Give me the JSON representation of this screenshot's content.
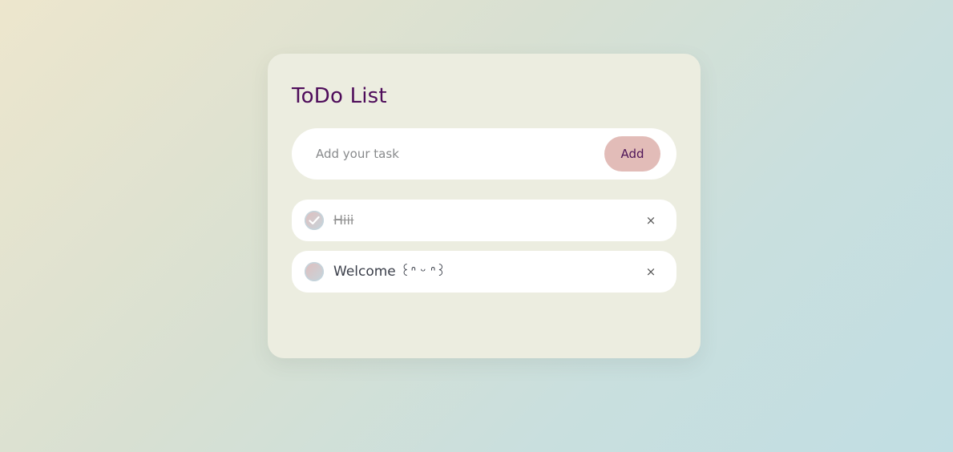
{
  "header": {
    "title": "ToDo List"
  },
  "new_task": {
    "placeholder": "Add your task",
    "value": "",
    "add_label": "Add"
  },
  "todos": [
    {
      "text": "Hiii",
      "done": true,
      "delete_label": "×"
    },
    {
      "text": "Welcome ꒰ᐢ ᵕ ᐢ꒱",
      "done": false,
      "delete_label": "×"
    }
  ],
  "icons": {
    "check": "check-icon"
  },
  "colors": {
    "title": "#4e0c5a",
    "add_button_bg": "#e2bcb8",
    "card_bg": "#ecede0"
  }
}
